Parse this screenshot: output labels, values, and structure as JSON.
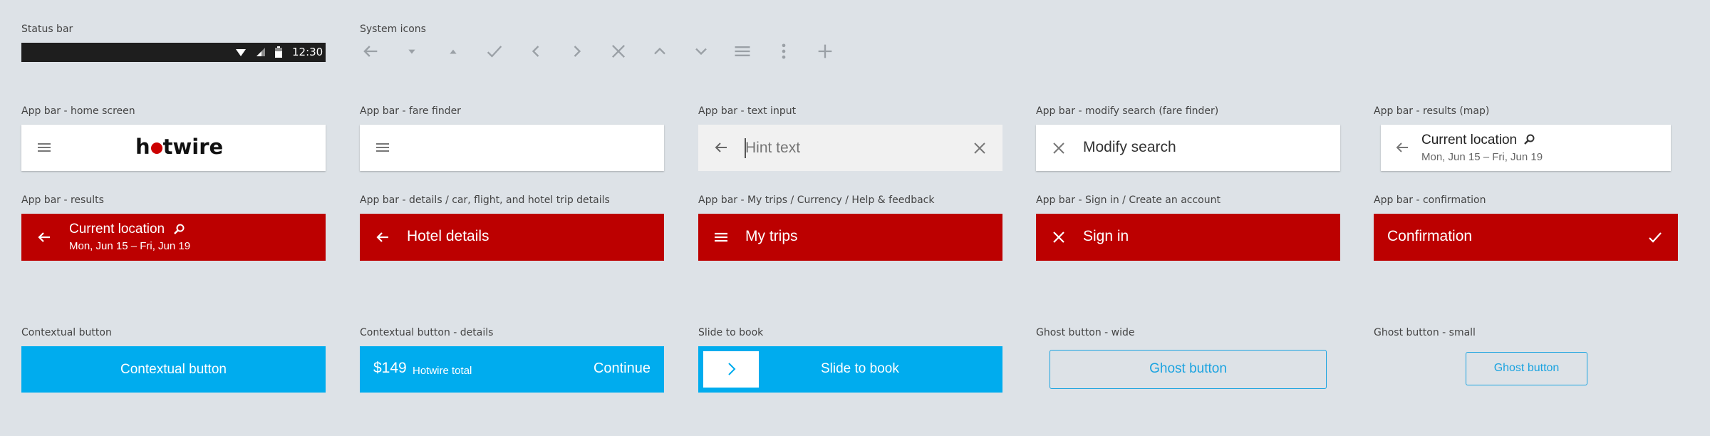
{
  "captions": {
    "status_bar": "Status bar",
    "system_icons": "System icons",
    "appbar_home": "App bar - home screen",
    "appbar_fare_finder": "App bar - fare finder",
    "appbar_text_input": "App bar - text input",
    "appbar_modify_search": "App bar - modify search (fare finder)",
    "appbar_results_map": "App bar - results (map)",
    "appbar_results": "App bar - results",
    "appbar_details": "App bar - details / car, flight, and hotel trip details",
    "appbar_mytrips": "App bar - My trips / Currency / Help & feedback",
    "appbar_signin": "App bar - Sign in / Create an account",
    "appbar_confirmation": "App bar - confirmation",
    "contextual_button": "Contextual button",
    "contextual_button_details": "Contextual button - details",
    "slide_to_book": "Slide to book",
    "ghost_wide": "Ghost button - wide",
    "ghost_small": "Ghost button - small"
  },
  "status_bar": {
    "time": "12:30"
  },
  "system_icons": [
    "arrow-left-icon",
    "caret-down-icon",
    "caret-up-icon",
    "check-icon",
    "chevron-left-icon",
    "chevron-right-icon",
    "close-icon",
    "chevron-up-icon",
    "chevron-down-icon",
    "menu-icon",
    "more-vert-icon",
    "plus-icon"
  ],
  "home": {
    "logo_pre": "h",
    "logo_post": "twire"
  },
  "text_input": {
    "placeholder": "Hint text"
  },
  "modify_search": {
    "title": "Modify search"
  },
  "results_map": {
    "title": "Current location",
    "dates": "Mon, Jun 15 – Fri, Jun 19"
  },
  "results": {
    "title": "Current location",
    "dates": "Mon, Jun 15 – Fri, Jun 19"
  },
  "details": {
    "title": "Hotel details"
  },
  "mytrips": {
    "title": "My trips"
  },
  "signin": {
    "title": "Sign in"
  },
  "confirmation": {
    "title": "Confirmation"
  },
  "contextual": {
    "label": "Contextual button"
  },
  "contextual_details": {
    "price": "$149",
    "price_label": "Hotwire total",
    "action": "Continue"
  },
  "slide": {
    "label": "Slide to book"
  },
  "ghost_wide": {
    "label": "Ghost button"
  },
  "ghost_small": {
    "label": "Ghost button"
  },
  "colors": {
    "red": "#bc0000",
    "blue": "#00acee",
    "ghost": "#1aa3e0",
    "background": "#dde2e7"
  }
}
